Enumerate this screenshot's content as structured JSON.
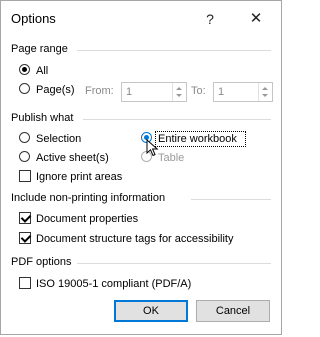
{
  "window": {
    "title": "Options",
    "help_glyph": "?",
    "close_glyph": "✕"
  },
  "page_range": {
    "heading": "Page range",
    "all_label": "All",
    "pages_label": "Page(s)",
    "from_label": "From:",
    "from_value": "1",
    "to_label": "To:",
    "to_value": "1",
    "selected": "All"
  },
  "publish_what": {
    "heading": "Publish what",
    "selection_label": "Selection",
    "active_sheets_label": "Active sheet(s)",
    "entire_workbook_label": "Entire workbook",
    "table_label": "Table",
    "ignore_print_areas_label": "Ignore print areas",
    "selected": "Entire workbook",
    "ignore_print_areas": false
  },
  "non_printing": {
    "heading": "Include non-printing information",
    "document_properties_label": "Document properties",
    "document_properties": true,
    "structure_tags_label": "Document structure tags for accessibility",
    "structure_tags": true
  },
  "pdf_options": {
    "heading": "PDF options",
    "iso_label": "ISO 19005-1 compliant (PDF/A)",
    "iso": false
  },
  "buttons": {
    "ok": "OK",
    "cancel": "Cancel"
  }
}
